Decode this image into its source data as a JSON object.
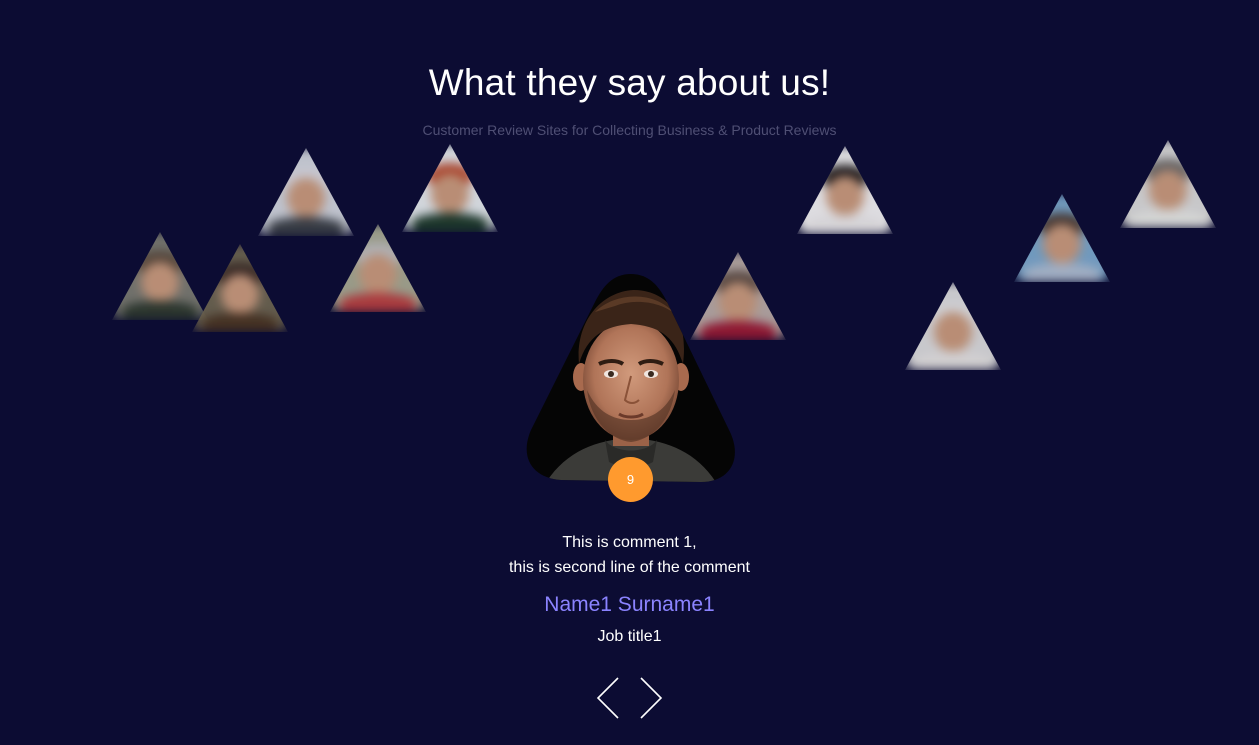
{
  "header": {
    "title": "What they say about us!",
    "subtitle": "Customer Review Sites for Collecting Business & Product Reviews"
  },
  "testimonial": {
    "badge": "9",
    "comment_line1": "This is comment 1,",
    "comment_line2": "this is second line of the comment",
    "name": "Name1 Surname1",
    "job_title": "Job title1"
  },
  "navigation": {
    "prev_icon": "chevron-left-icon",
    "next_icon": "chevron-right-icon"
  },
  "colors": {
    "background": "#0c0c33",
    "badge": "#ff9a2e",
    "name": "#8b83ff",
    "subtitle": "#4f4f74"
  },
  "background_avatars": [
    {
      "id": "bg-avatar-1",
      "hair": "#5b4a3a",
      "bg": "#7a7a70",
      "body": "#2f3a2e"
    },
    {
      "id": "bg-avatar-2",
      "hair": "#3a2a22",
      "bg": "#6c6450",
      "body": "#4a3522"
    },
    {
      "id": "bg-avatar-3",
      "hair": "#d8d8de",
      "bg": "#cfd3da",
      "body": "#3b4046"
    },
    {
      "id": "bg-avatar-4",
      "hair": "#c0c0c0",
      "bg": "#a6a890",
      "body": "#b84040"
    },
    {
      "id": "bg-avatar-5",
      "hair": "#b84b2e",
      "bg": "#e3e8ea",
      "body": "#1f3b2b"
    },
    {
      "id": "bg-avatar-6",
      "hair": "#5a4a40",
      "bg": "#b7a9a3",
      "body": "#9a1a33"
    },
    {
      "id": "bg-avatar-7",
      "hair": "#1e1a18",
      "bg": "#f0efef",
      "body": "#e8e6e6"
    },
    {
      "id": "bg-avatar-8",
      "hair": "#e0e0e0",
      "bg": "#d9d9d9",
      "body": "#e3e1df"
    },
    {
      "id": "bg-avatar-9",
      "hair": "#4a3a30",
      "bg": "#7aa6c9",
      "body": "#aebdd0"
    },
    {
      "id": "bg-avatar-10",
      "hair": "#6d6a66",
      "bg": "#d8d8d6",
      "body": "#e5e6e2"
    }
  ]
}
